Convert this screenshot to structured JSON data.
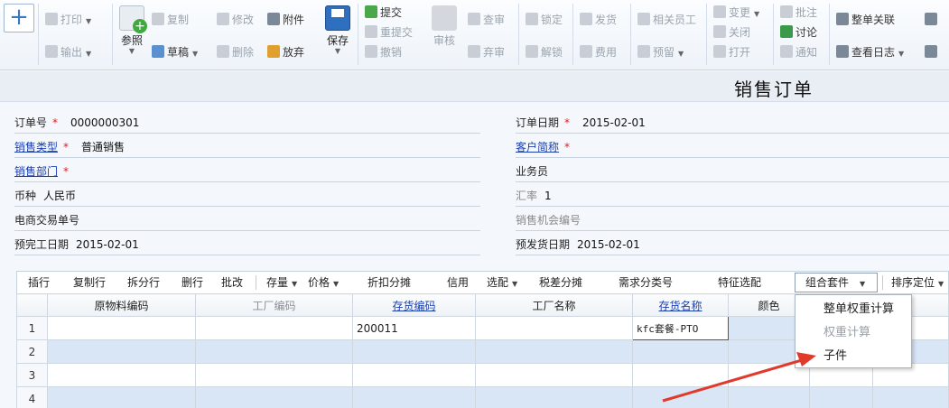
{
  "toolbar": {
    "print": "打印",
    "export": "输出",
    "reference": "参照",
    "copy": "复制",
    "draft": "草稿",
    "modify": "修改",
    "delete": "删除",
    "attach": "附件",
    "discard": "放弃",
    "save": "保存",
    "submit": "提交",
    "resubmit": "重提交",
    "withdraw": "撤销",
    "audit": "审核",
    "view_audit": "查审",
    "abandon_audit": "弃审",
    "lock": "锁定",
    "unlock": "解锁",
    "ship": "发货",
    "expense": "费用",
    "related_staff": "相关员工",
    "reserve": "预留",
    "change": "变更",
    "close": "关闭",
    "open": "打开",
    "annotate": "批注",
    "discuss": "讨论",
    "notify": "通知",
    "order_link": "整单关联",
    "view_log": "查看日志"
  },
  "page": {
    "title": "销售订单"
  },
  "form": {
    "order_no": {
      "label": "订单号",
      "value": "0000000301"
    },
    "order_date": {
      "label": "订单日期",
      "value": "2015-02-01"
    },
    "sales_type": {
      "label": "销售类型",
      "value": "普通销售"
    },
    "customer_abbr": {
      "label": "客户简称",
      "value": ""
    },
    "sales_dept": {
      "label": "销售部门",
      "value": ""
    },
    "salesperson": {
      "label": "业务员",
      "value": ""
    },
    "currency": {
      "label": "币种",
      "value": "人民币"
    },
    "exchange_rate": {
      "label": "汇率",
      "value": "1"
    },
    "ecommerce_no": {
      "label": "电商交易单号",
      "value": ""
    },
    "opportunity_no": {
      "label": "销售机会编号",
      "value": ""
    },
    "planned_finish": {
      "label": "预完工日期",
      "value": "2015-02-01"
    },
    "planned_ship": {
      "label": "预发货日期",
      "value": "2015-02-01"
    }
  },
  "gridbar": {
    "insert_row": "插行",
    "copy_row": "复制行",
    "split_row": "拆分行",
    "delete_row": "删行",
    "batch_edit": "批改",
    "stock": "存量",
    "price": "价格",
    "discount_split": "折扣分摊",
    "credit": "信用",
    "select_config": "选配",
    "tax_diff_split": "税差分摊",
    "demand_class": "需求分类号",
    "feature_select": "特征选配",
    "combo_kit": "组合套件",
    "sort_locate": "排序定位"
  },
  "grid": {
    "columns": [
      "原物料编码",
      "工厂编码",
      "存货编码",
      "工厂名称",
      "存货名称",
      "颜色"
    ],
    "rows": [
      {
        "no": "1",
        "raw_code": "",
        "factory_code": "",
        "inv_code": "200011",
        "factory_name": "",
        "inv_name": "kfc套餐-PTO",
        "color": ""
      },
      {
        "no": "2"
      },
      {
        "no": "3"
      },
      {
        "no": "4"
      }
    ]
  },
  "popup": {
    "items": [
      {
        "label": "整单权重计算",
        "enabled": true
      },
      {
        "label": "权重计算",
        "enabled": false
      },
      {
        "label": "子件",
        "enabled": true
      }
    ]
  },
  "colors": {
    "accent": "#1a3fb0",
    "required": "#e02020",
    "arrow": "#e23a2a"
  }
}
